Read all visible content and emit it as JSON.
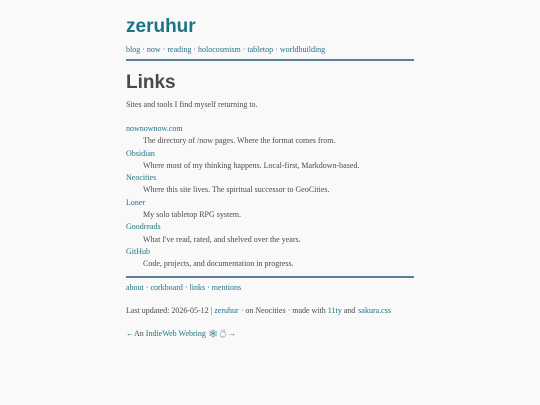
{
  "site": {
    "title": "zeruhur"
  },
  "nav": [
    "blog",
    "now",
    "reading",
    "holocosmism",
    "tabletop",
    "worldbuilding"
  ],
  "nav_separator": "·",
  "page": {
    "title": "Links",
    "intro": "Sites and tools I find myself returning to."
  },
  "links": [
    {
      "name": "nownownow.com",
      "desc": "The directory of /now pages. Where the format comes from."
    },
    {
      "name": "Obsidian",
      "desc": "Where most of my thinking happens. Local-first, Markdown-based."
    },
    {
      "name": "Neocities",
      "desc": "Where this site lives. The spiritual successor to GeoCities."
    },
    {
      "name": "Loner",
      "desc": "My solo tabletop RPG system."
    },
    {
      "name": "Goodreads",
      "desc": "What I've read, rated, and shelved over the years."
    },
    {
      "name": "GitHub",
      "desc": "Code, projects, and documentation in progress."
    }
  ],
  "footer_nav": [
    "about",
    "corkboard",
    "links",
    "mentions"
  ],
  "footer": {
    "updated_prefix": "Last updated: 2026-05-12 |",
    "author": "zeruhur",
    "host_text": "· on Neocities · made with",
    "tool1": "11ty",
    "and_text": "and",
    "tool2": "sakura.css"
  },
  "webring": {
    "prev": "←",
    "text": "An",
    "name": "IndieWeb Webring",
    "emoji": "🕸💍",
    "next": "→"
  },
  "colors": {
    "link": "#1d7484",
    "text": "#4a4a4a",
    "rule": "#5b7f96",
    "background": "#f9f9f9"
  }
}
